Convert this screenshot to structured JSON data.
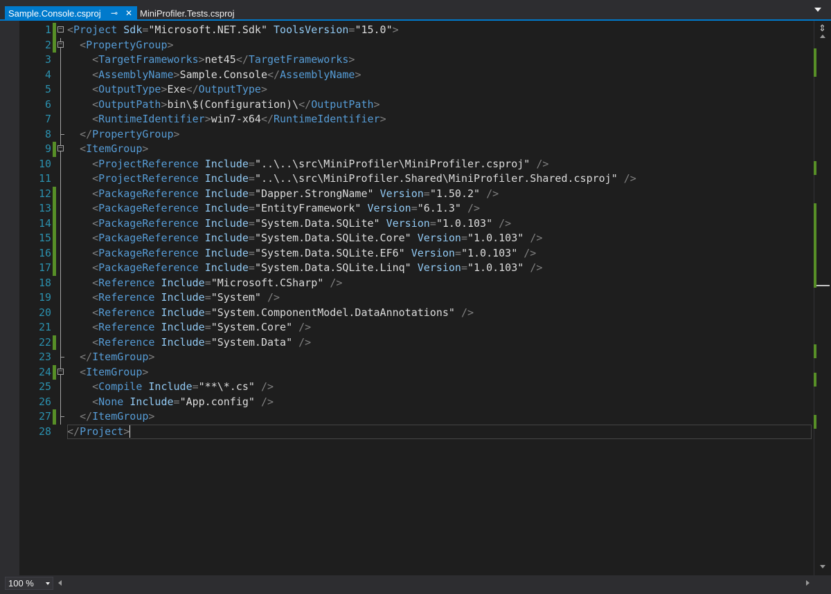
{
  "tabs": {
    "active_label": "Sample.Console.csproj",
    "inactive_label": "MiniProfiler.Tests.csproj",
    "pin_icon": "pin-icon",
    "close_icon": "close-icon"
  },
  "editor": {
    "line_numbers": [
      "1",
      "2",
      "3",
      "4",
      "5",
      "6",
      "7",
      "8",
      "9",
      "10",
      "11",
      "12",
      "13",
      "14",
      "15",
      "16",
      "17",
      "18",
      "19",
      "20",
      "21",
      "22",
      "23",
      "24",
      "25",
      "26",
      "27",
      "28"
    ],
    "changed_lines": [
      1,
      2,
      9,
      12,
      13,
      14,
      15,
      16,
      17,
      22,
      24,
      27
    ],
    "current_line": 28,
    "colors": {
      "background": "#1e1e1e",
      "line_number": "#2b91af",
      "xml_delimiter": "#808080",
      "xml_tag": "#569cd6",
      "xml_attribute": "#92caf4",
      "xml_text": "#dcdcdc",
      "change_marker": "#578f27",
      "tab_accent": "#007acc"
    },
    "lines": [
      {
        "indent": 0,
        "fold": "open",
        "tokens": [
          [
            "p",
            "<"
          ],
          [
            "t",
            "Project"
          ],
          [
            "x",
            " "
          ],
          [
            "a",
            "Sdk"
          ],
          [
            "p",
            "="
          ],
          [
            "s",
            "\"Microsoft.NET.Sdk\""
          ],
          [
            "x",
            " "
          ],
          [
            "a",
            "ToolsVersion"
          ],
          [
            "p",
            "="
          ],
          [
            "s",
            "\"15.0\""
          ],
          [
            "p",
            ">"
          ]
        ]
      },
      {
        "indent": 2,
        "fold": "open",
        "tokens": [
          [
            "p",
            "<"
          ],
          [
            "t",
            "PropertyGroup"
          ],
          [
            "p",
            ">"
          ]
        ]
      },
      {
        "indent": 4,
        "fold": "line",
        "tokens": [
          [
            "p",
            "<"
          ],
          [
            "t",
            "TargetFrameworks"
          ],
          [
            "p",
            ">"
          ],
          [
            "x",
            "net45"
          ],
          [
            "p",
            "</"
          ],
          [
            "t",
            "TargetFrameworks"
          ],
          [
            "p",
            ">"
          ]
        ]
      },
      {
        "indent": 4,
        "fold": "line",
        "tokens": [
          [
            "p",
            "<"
          ],
          [
            "t",
            "AssemblyName"
          ],
          [
            "p",
            ">"
          ],
          [
            "x",
            "Sample.Console"
          ],
          [
            "p",
            "</"
          ],
          [
            "t",
            "AssemblyName"
          ],
          [
            "p",
            ">"
          ]
        ]
      },
      {
        "indent": 4,
        "fold": "line",
        "tokens": [
          [
            "p",
            "<"
          ],
          [
            "t",
            "OutputType"
          ],
          [
            "p",
            ">"
          ],
          [
            "x",
            "Exe"
          ],
          [
            "p",
            "</"
          ],
          [
            "t",
            "OutputType"
          ],
          [
            "p",
            ">"
          ]
        ]
      },
      {
        "indent": 4,
        "fold": "line",
        "tokens": [
          [
            "p",
            "<"
          ],
          [
            "t",
            "OutputPath"
          ],
          [
            "p",
            ">"
          ],
          [
            "x",
            "bin\\$(Configuration)\\"
          ],
          [
            "p",
            "</"
          ],
          [
            "t",
            "OutputPath"
          ],
          [
            "p",
            ">"
          ]
        ]
      },
      {
        "indent": 4,
        "fold": "line",
        "tokens": [
          [
            "p",
            "<"
          ],
          [
            "t",
            "RuntimeIdentifier"
          ],
          [
            "p",
            ">"
          ],
          [
            "x",
            "win7-x64"
          ],
          [
            "p",
            "</"
          ],
          [
            "t",
            "RuntimeIdentifier"
          ],
          [
            "p",
            ">"
          ]
        ]
      },
      {
        "indent": 2,
        "fold": "end",
        "tokens": [
          [
            "p",
            "</"
          ],
          [
            "t",
            "PropertyGroup"
          ],
          [
            "p",
            ">"
          ]
        ]
      },
      {
        "indent": 2,
        "fold": "open",
        "tokens": [
          [
            "p",
            "<"
          ],
          [
            "t",
            "ItemGroup"
          ],
          [
            "p",
            ">"
          ]
        ]
      },
      {
        "indent": 4,
        "fold": "line",
        "tokens": [
          [
            "p",
            "<"
          ],
          [
            "t",
            "ProjectReference"
          ],
          [
            "x",
            " "
          ],
          [
            "a",
            "Include"
          ],
          [
            "p",
            "="
          ],
          [
            "s",
            "\"..\\..\\src\\MiniProfiler\\MiniProfiler.csproj\""
          ],
          [
            "x",
            " "
          ],
          [
            "p",
            "/>"
          ]
        ]
      },
      {
        "indent": 4,
        "fold": "line",
        "tokens": [
          [
            "p",
            "<"
          ],
          [
            "t",
            "ProjectReference"
          ],
          [
            "x",
            " "
          ],
          [
            "a",
            "Include"
          ],
          [
            "p",
            "="
          ],
          [
            "s",
            "\"..\\..\\src\\MiniProfiler.Shared\\MiniProfiler.Shared.csproj\""
          ],
          [
            "x",
            " "
          ],
          [
            "p",
            "/>"
          ]
        ]
      },
      {
        "indent": 4,
        "fold": "line",
        "tokens": [
          [
            "p",
            "<"
          ],
          [
            "t",
            "PackageReference"
          ],
          [
            "x",
            " "
          ],
          [
            "a",
            "Include"
          ],
          [
            "p",
            "="
          ],
          [
            "s",
            "\"Dapper.StrongName\""
          ],
          [
            "x",
            " "
          ],
          [
            "a",
            "Version"
          ],
          [
            "p",
            "="
          ],
          [
            "s",
            "\"1.50.2\""
          ],
          [
            "x",
            " "
          ],
          [
            "p",
            "/>"
          ]
        ]
      },
      {
        "indent": 4,
        "fold": "line",
        "tokens": [
          [
            "p",
            "<"
          ],
          [
            "t",
            "PackageReference"
          ],
          [
            "x",
            " "
          ],
          [
            "a",
            "Include"
          ],
          [
            "p",
            "="
          ],
          [
            "s",
            "\"EntityFramework\""
          ],
          [
            "x",
            " "
          ],
          [
            "a",
            "Version"
          ],
          [
            "p",
            "="
          ],
          [
            "s",
            "\"6.1.3\""
          ],
          [
            "x",
            " "
          ],
          [
            "p",
            "/>"
          ]
        ]
      },
      {
        "indent": 4,
        "fold": "line",
        "tokens": [
          [
            "p",
            "<"
          ],
          [
            "t",
            "PackageReference"
          ],
          [
            "x",
            " "
          ],
          [
            "a",
            "Include"
          ],
          [
            "p",
            "="
          ],
          [
            "s",
            "\"System.Data.SQLite\""
          ],
          [
            "x",
            " "
          ],
          [
            "a",
            "Version"
          ],
          [
            "p",
            "="
          ],
          [
            "s",
            "\"1.0.103\""
          ],
          [
            "x",
            " "
          ],
          [
            "p",
            "/>"
          ]
        ]
      },
      {
        "indent": 4,
        "fold": "line",
        "tokens": [
          [
            "p",
            "<"
          ],
          [
            "t",
            "PackageReference"
          ],
          [
            "x",
            " "
          ],
          [
            "a",
            "Include"
          ],
          [
            "p",
            "="
          ],
          [
            "s",
            "\"System.Data.SQLite.Core\""
          ],
          [
            "x",
            " "
          ],
          [
            "a",
            "Version"
          ],
          [
            "p",
            "="
          ],
          [
            "s",
            "\"1.0.103\""
          ],
          [
            "x",
            " "
          ],
          [
            "p",
            "/>"
          ]
        ]
      },
      {
        "indent": 4,
        "fold": "line",
        "tokens": [
          [
            "p",
            "<"
          ],
          [
            "t",
            "PackageReference"
          ],
          [
            "x",
            " "
          ],
          [
            "a",
            "Include"
          ],
          [
            "p",
            "="
          ],
          [
            "s",
            "\"System.Data.SQLite.EF6\""
          ],
          [
            "x",
            " "
          ],
          [
            "a",
            "Version"
          ],
          [
            "p",
            "="
          ],
          [
            "s",
            "\"1.0.103\""
          ],
          [
            "x",
            " "
          ],
          [
            "p",
            "/>"
          ]
        ]
      },
      {
        "indent": 4,
        "fold": "line",
        "tokens": [
          [
            "p",
            "<"
          ],
          [
            "t",
            "PackageReference"
          ],
          [
            "x",
            " "
          ],
          [
            "a",
            "Include"
          ],
          [
            "p",
            "="
          ],
          [
            "s",
            "\"System.Data.SQLite.Linq\""
          ],
          [
            "x",
            " "
          ],
          [
            "a",
            "Version"
          ],
          [
            "p",
            "="
          ],
          [
            "s",
            "\"1.0.103\""
          ],
          [
            "x",
            " "
          ],
          [
            "p",
            "/>"
          ]
        ]
      },
      {
        "indent": 4,
        "fold": "line",
        "tokens": [
          [
            "p",
            "<"
          ],
          [
            "t",
            "Reference"
          ],
          [
            "x",
            " "
          ],
          [
            "a",
            "Include"
          ],
          [
            "p",
            "="
          ],
          [
            "s",
            "\"Microsoft.CSharp\""
          ],
          [
            "x",
            " "
          ],
          [
            "p",
            "/>"
          ]
        ]
      },
      {
        "indent": 4,
        "fold": "line",
        "tokens": [
          [
            "p",
            "<"
          ],
          [
            "t",
            "Reference"
          ],
          [
            "x",
            " "
          ],
          [
            "a",
            "Include"
          ],
          [
            "p",
            "="
          ],
          [
            "s",
            "\"System\""
          ],
          [
            "x",
            " "
          ],
          [
            "p",
            "/>"
          ]
        ]
      },
      {
        "indent": 4,
        "fold": "line",
        "tokens": [
          [
            "p",
            "<"
          ],
          [
            "t",
            "Reference"
          ],
          [
            "x",
            " "
          ],
          [
            "a",
            "Include"
          ],
          [
            "p",
            "="
          ],
          [
            "s",
            "\"System.ComponentModel.DataAnnotations\""
          ],
          [
            "x",
            " "
          ],
          [
            "p",
            "/>"
          ]
        ]
      },
      {
        "indent": 4,
        "fold": "line",
        "tokens": [
          [
            "p",
            "<"
          ],
          [
            "t",
            "Reference"
          ],
          [
            "x",
            " "
          ],
          [
            "a",
            "Include"
          ],
          [
            "p",
            "="
          ],
          [
            "s",
            "\"System.Core\""
          ],
          [
            "x",
            " "
          ],
          [
            "p",
            "/>"
          ]
        ]
      },
      {
        "indent": 4,
        "fold": "line",
        "tokens": [
          [
            "p",
            "<"
          ],
          [
            "t",
            "Reference"
          ],
          [
            "x",
            " "
          ],
          [
            "a",
            "Include"
          ],
          [
            "p",
            "="
          ],
          [
            "s",
            "\"System.Data\""
          ],
          [
            "x",
            " "
          ],
          [
            "p",
            "/>"
          ]
        ]
      },
      {
        "indent": 2,
        "fold": "end",
        "tokens": [
          [
            "p",
            "</"
          ],
          [
            "t",
            "ItemGroup"
          ],
          [
            "p",
            ">"
          ]
        ]
      },
      {
        "indent": 2,
        "fold": "open",
        "tokens": [
          [
            "p",
            "<"
          ],
          [
            "t",
            "ItemGroup"
          ],
          [
            "p",
            ">"
          ]
        ]
      },
      {
        "indent": 4,
        "fold": "line",
        "tokens": [
          [
            "p",
            "<"
          ],
          [
            "t",
            "Compile"
          ],
          [
            "x",
            " "
          ],
          [
            "a",
            "Include"
          ],
          [
            "p",
            "="
          ],
          [
            "s",
            "\"**\\*.cs\""
          ],
          [
            "x",
            " "
          ],
          [
            "p",
            "/>"
          ]
        ]
      },
      {
        "indent": 4,
        "fold": "line",
        "tokens": [
          [
            "p",
            "<"
          ],
          [
            "t",
            "None"
          ],
          [
            "x",
            " "
          ],
          [
            "a",
            "Include"
          ],
          [
            "p",
            "="
          ],
          [
            "s",
            "\"App.config\""
          ],
          [
            "x",
            " "
          ],
          [
            "p",
            "/>"
          ]
        ]
      },
      {
        "indent": 2,
        "fold": "end",
        "tokens": [
          [
            "p",
            "</"
          ],
          [
            "t",
            "ItemGroup"
          ],
          [
            "p",
            ">"
          ]
        ]
      },
      {
        "indent": 0,
        "fold": "end",
        "tokens": [
          [
            "p",
            "</"
          ],
          [
            "t",
            "Project"
          ],
          [
            "p",
            ">"
          ]
        ]
      }
    ]
  },
  "scrollbar": {
    "split_icon": "split-icon",
    "change_marker_rows": [
      1,
      2,
      9,
      12,
      13,
      14,
      15,
      16,
      17,
      22,
      24,
      27
    ]
  },
  "bottom_bar": {
    "zoom_label": "100 %"
  }
}
